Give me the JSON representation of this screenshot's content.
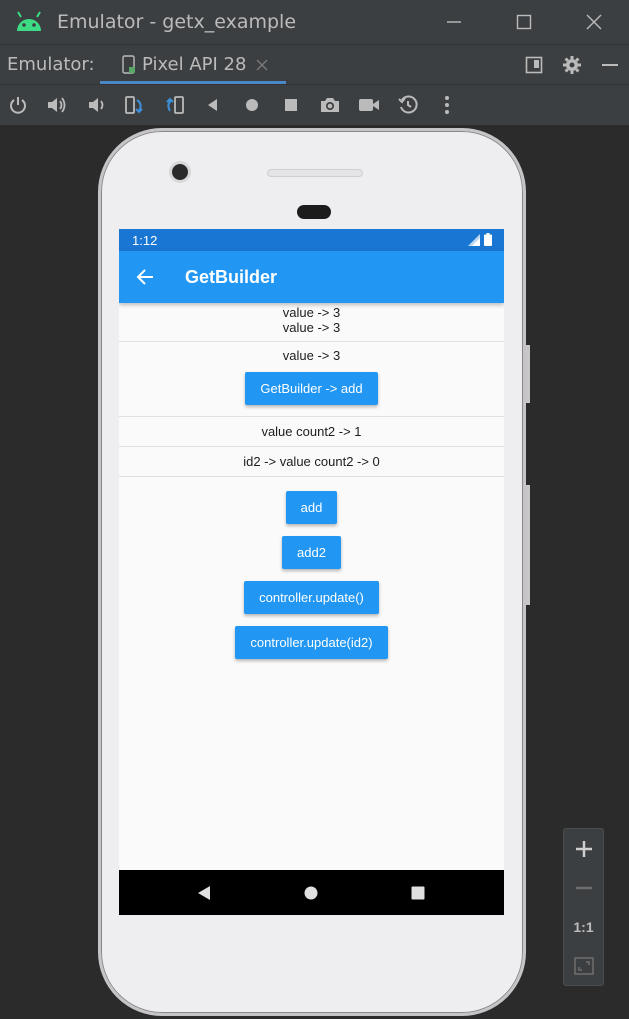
{
  "window": {
    "title": "Emulator - getx_example",
    "minimize_icon": "minimize-icon",
    "maximize_icon": "maximize-icon",
    "close_icon": "close-icon"
  },
  "tabs": {
    "label": "Emulator:",
    "active_tab": "Pixel API 28"
  },
  "toolbar": {
    "icons": [
      "power-icon",
      "volume-up-icon",
      "volume-down-icon",
      "rotate-left-icon",
      "rotate-right-icon",
      "back-icon",
      "home-icon",
      "overview-icon",
      "screenshot-icon",
      "record-icon",
      "snapshot-icon",
      "more-icon"
    ]
  },
  "device": {
    "status": {
      "time": "1:12"
    },
    "appbar": {
      "title": "GetBuilder"
    },
    "content": {
      "section1_line1": "value -> 3",
      "section1_line2": "value -> 3",
      "section2_value": "value -> 3",
      "section2_button": "GetBuilder -> add",
      "count2_text": "value count2 -> 1",
      "id2_text": "id2 -> value count2 -> 0",
      "buttons": {
        "add": "add",
        "add2": "add2",
        "update": "controller.update()",
        "update_id2": "controller.update(id2)"
      }
    }
  },
  "zoom": {
    "plus": "+",
    "minus": "−",
    "one_to_one": "1:1"
  },
  "colors": {
    "primary": "#2196f3",
    "status_bar": "#1976d2",
    "ide_bg": "#3c3f41",
    "tab_underline": "#4a88c7"
  }
}
